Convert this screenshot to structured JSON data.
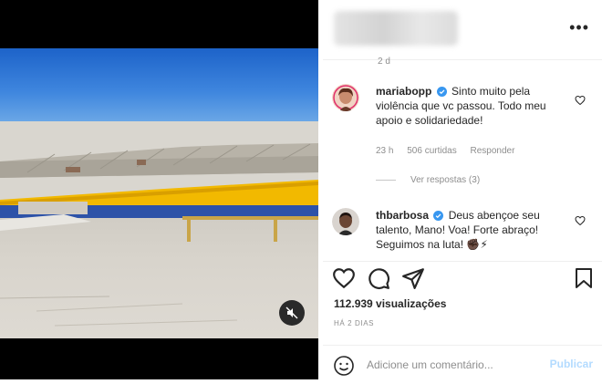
{
  "post_header": {
    "top_meta": "2 d"
  },
  "comments": [
    {
      "username": "mariabopp",
      "text": "Sinto muito pela violência que vc passou. Todo meu apoio e solidariedade!",
      "time": "23 h",
      "likes": "506 curtidas",
      "reply_label": "Responder",
      "view_replies": "Ver respostas (3)"
    },
    {
      "username": "thbarbosa",
      "text": "Deus abençoe seu talento, Mano! Voa! Forte abraço! Seguimos na luta! ✊🏿⚡"
    }
  ],
  "stats": {
    "views": "112.939 visualizações",
    "date": "HÁ 2 DIAS"
  },
  "add_comment": {
    "placeholder": "Adicione um comentário...",
    "publish_label": "Publicar"
  },
  "colors": {
    "verified": "#3897f0",
    "publish_disabled": "#b3dbff",
    "sky": "#2f78d6",
    "roof_trim": "#f2b900"
  },
  "icons": [
    "more-options-icon",
    "heart-icon",
    "comment-icon",
    "share-icon",
    "save-icon",
    "emoji-icon",
    "mute-icon",
    "verified-icon"
  ]
}
